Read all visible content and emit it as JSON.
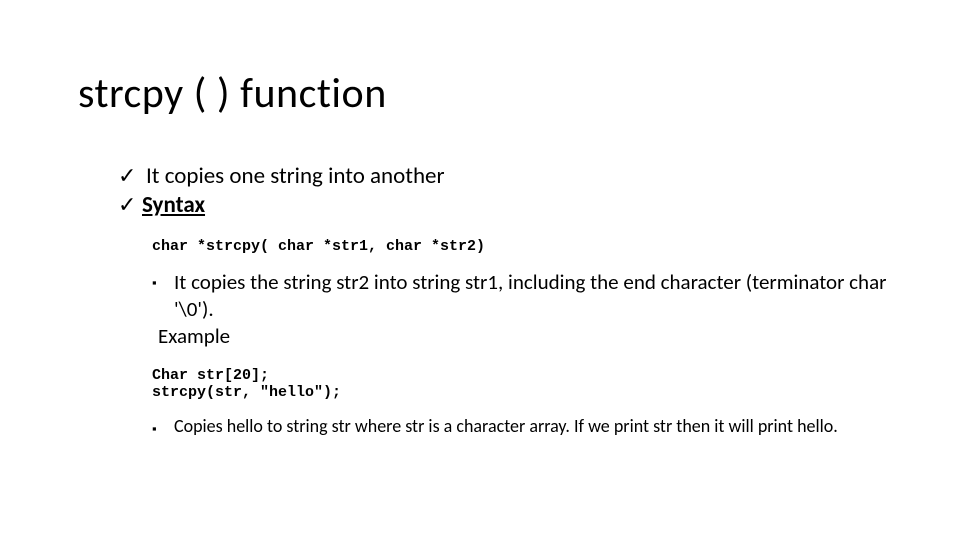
{
  "title": "strcpy ( ) function",
  "bullets": {
    "check1": "It copies one string into another",
    "check2": "Syntax"
  },
  "code1": "char *strcpy( char *str1, char *str2)",
  "sq1": "It copies the string str2 into string str1, including the end character (terminator char '\\0').",
  "example_label": "Example",
  "code2": "Char str[20];\nstrcpy(str, \"hello\");",
  "sq2": "Copies hello to string str where str is a character array. If we print str then it will print hello."
}
